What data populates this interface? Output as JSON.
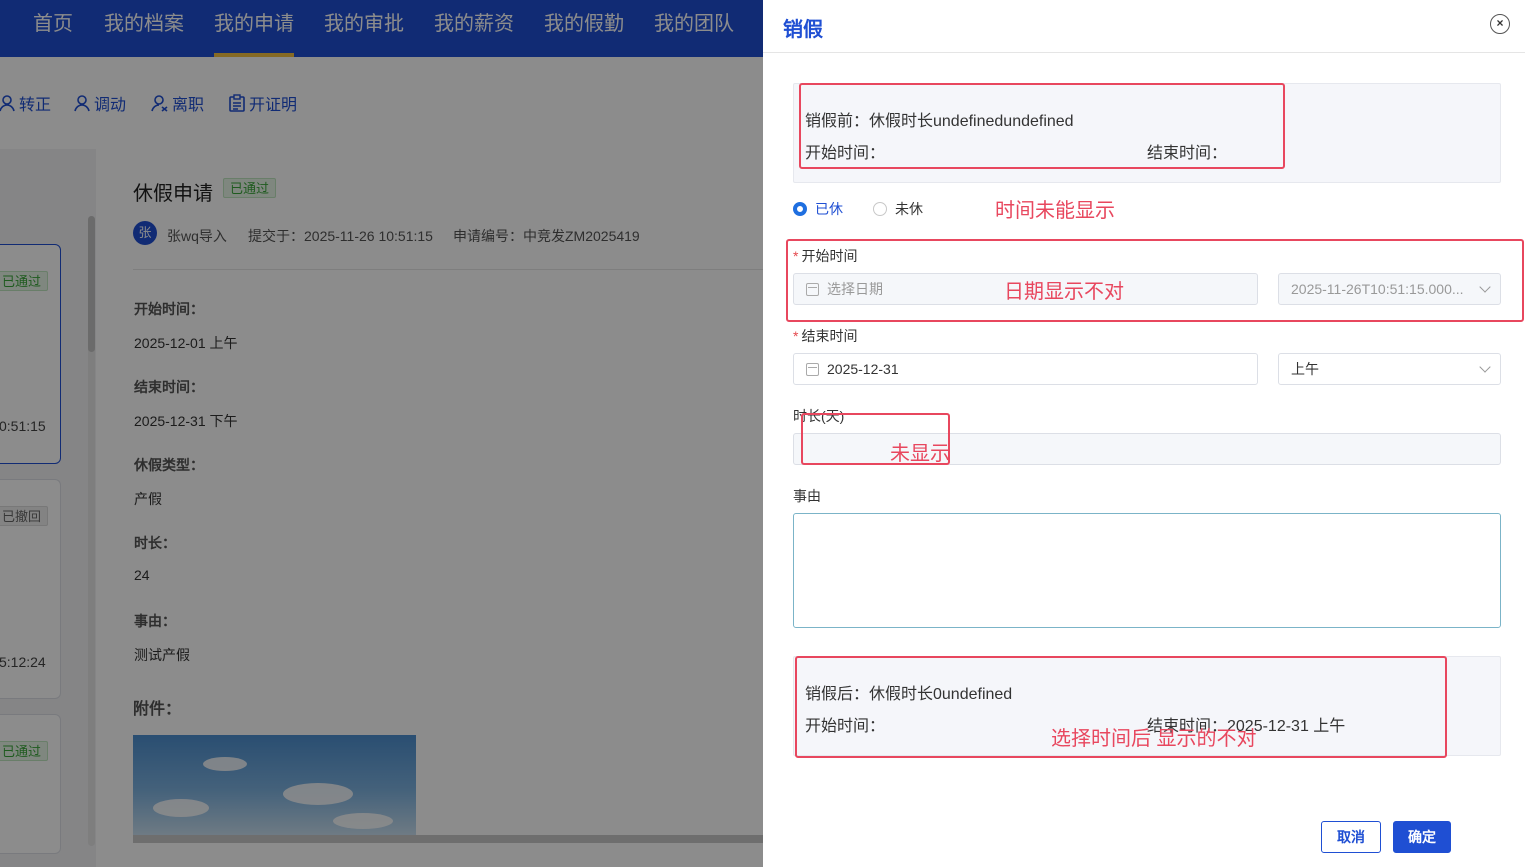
{
  "nav": {
    "items": [
      "首页",
      "我的档案",
      "我的申请",
      "我的审批",
      "我的薪资",
      "我的假勤",
      "我的团队"
    ],
    "active_index": 2
  },
  "actions": [
    "转正",
    "调动",
    "离职",
    "开证明"
  ],
  "list_cards": [
    {
      "tag": "已通过",
      "status": "pass",
      "time": "0:51:15"
    },
    {
      "tag": "已撤回",
      "status": "revoked",
      "time": "5:12:24"
    },
    {
      "tag": "已通过",
      "status": "pass",
      "time": ""
    }
  ],
  "detail": {
    "title": "休假申请",
    "status_tag": "已通过",
    "avatar_char": "张",
    "applicant": "张wq导入",
    "submitted": "提交于：2025-11-26 10:51:15",
    "application_no": "申请编号：中竞发ZM2025419",
    "fields": [
      {
        "label": "开始时间：",
        "value": "2025-12-01 上午"
      },
      {
        "label": "结束时间：",
        "value": "2025-12-31 下午"
      },
      {
        "label": "休假类型：",
        "value": "产假"
      },
      {
        "label": "时长：",
        "value": "24"
      },
      {
        "label": "事由：",
        "value": "测试产假"
      }
    ],
    "attachments_label": "附件："
  },
  "drawer": {
    "title": "销假",
    "close_glyph": "×",
    "before": {
      "summary": "销假前：休假时长undefinedundefined",
      "start_label": "开始时间：",
      "end_label": "结束时间："
    },
    "radio": {
      "options": [
        "已休",
        "未休"
      ],
      "selected": "已休"
    },
    "start_time": {
      "label": "开始时间",
      "date_placeholder": "选择日期",
      "period_value": "2025-11-26T10:51:15.000..."
    },
    "end_time": {
      "label": "结束时间",
      "date_value": "2025-12-31",
      "period_value": "上午"
    },
    "duration": {
      "label": "时长(天)",
      "value": ""
    },
    "reason": {
      "label": "事由",
      "value": ""
    },
    "after": {
      "summary": "销假后：休假时长0undefined",
      "start_label": "开始时间：",
      "end_label": "结束时间：",
      "end_value": "2025-12-31 上午"
    },
    "buttons": {
      "cancel": "取消",
      "ok": "确定"
    }
  },
  "annotations": [
    "时间未能显示",
    "日期显示不对",
    "未显示",
    "选择时间后 显示的不对"
  ],
  "colors": {
    "brand": "#1f4fd3",
    "annotation": "#e8475e",
    "success": "#3aa63a"
  }
}
